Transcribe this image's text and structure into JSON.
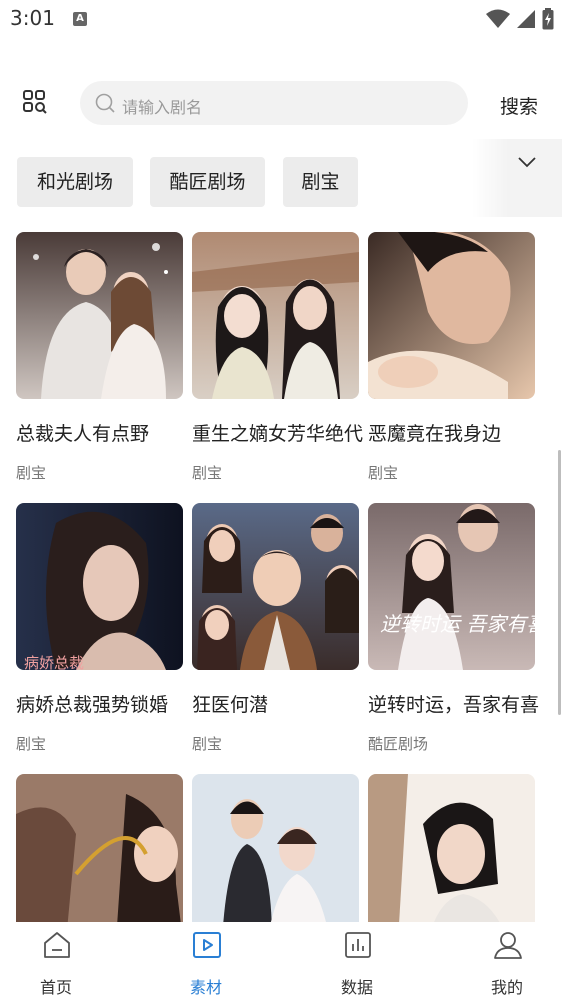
{
  "status_bar": {
    "time": "3:01",
    "notification_icon": "A"
  },
  "header": {
    "search_placeholder": "请输入剧名",
    "search_button": "搜索"
  },
  "chips": [
    "和光剧场",
    "酷匠剧场",
    "剧宝"
  ],
  "grid": [
    {
      "title": "总裁夫人有点野",
      "source": "剧宝"
    },
    {
      "title": "重生之嫡女芳华绝代",
      "source": "剧宝"
    },
    {
      "title": "恶魔竟在我身边",
      "source": "剧宝"
    },
    {
      "title": "病娇总裁强势锁婚",
      "source": "剧宝",
      "poster_text": "病娇总裁"
    },
    {
      "title": "狂医何潜",
      "source": "剧宝"
    },
    {
      "title": "逆转时运，吾家有喜",
      "source": "酷匠剧场",
      "poster_text": "逆转时运 吾家有喜"
    },
    {
      "title": "",
      "source": ""
    },
    {
      "title": "",
      "source": ""
    },
    {
      "title": "",
      "source": ""
    }
  ],
  "nav": [
    {
      "label": "首页",
      "icon": "home-icon"
    },
    {
      "label": "素材",
      "icon": "play-square-icon",
      "active": true
    },
    {
      "label": "数据",
      "icon": "bar-chart-icon"
    },
    {
      "label": "我的",
      "icon": "user-icon"
    }
  ],
  "colors": {
    "accent": "#2a7fd4",
    "chip_bg": "#ececec",
    "search_bg": "#f2f2f2"
  }
}
